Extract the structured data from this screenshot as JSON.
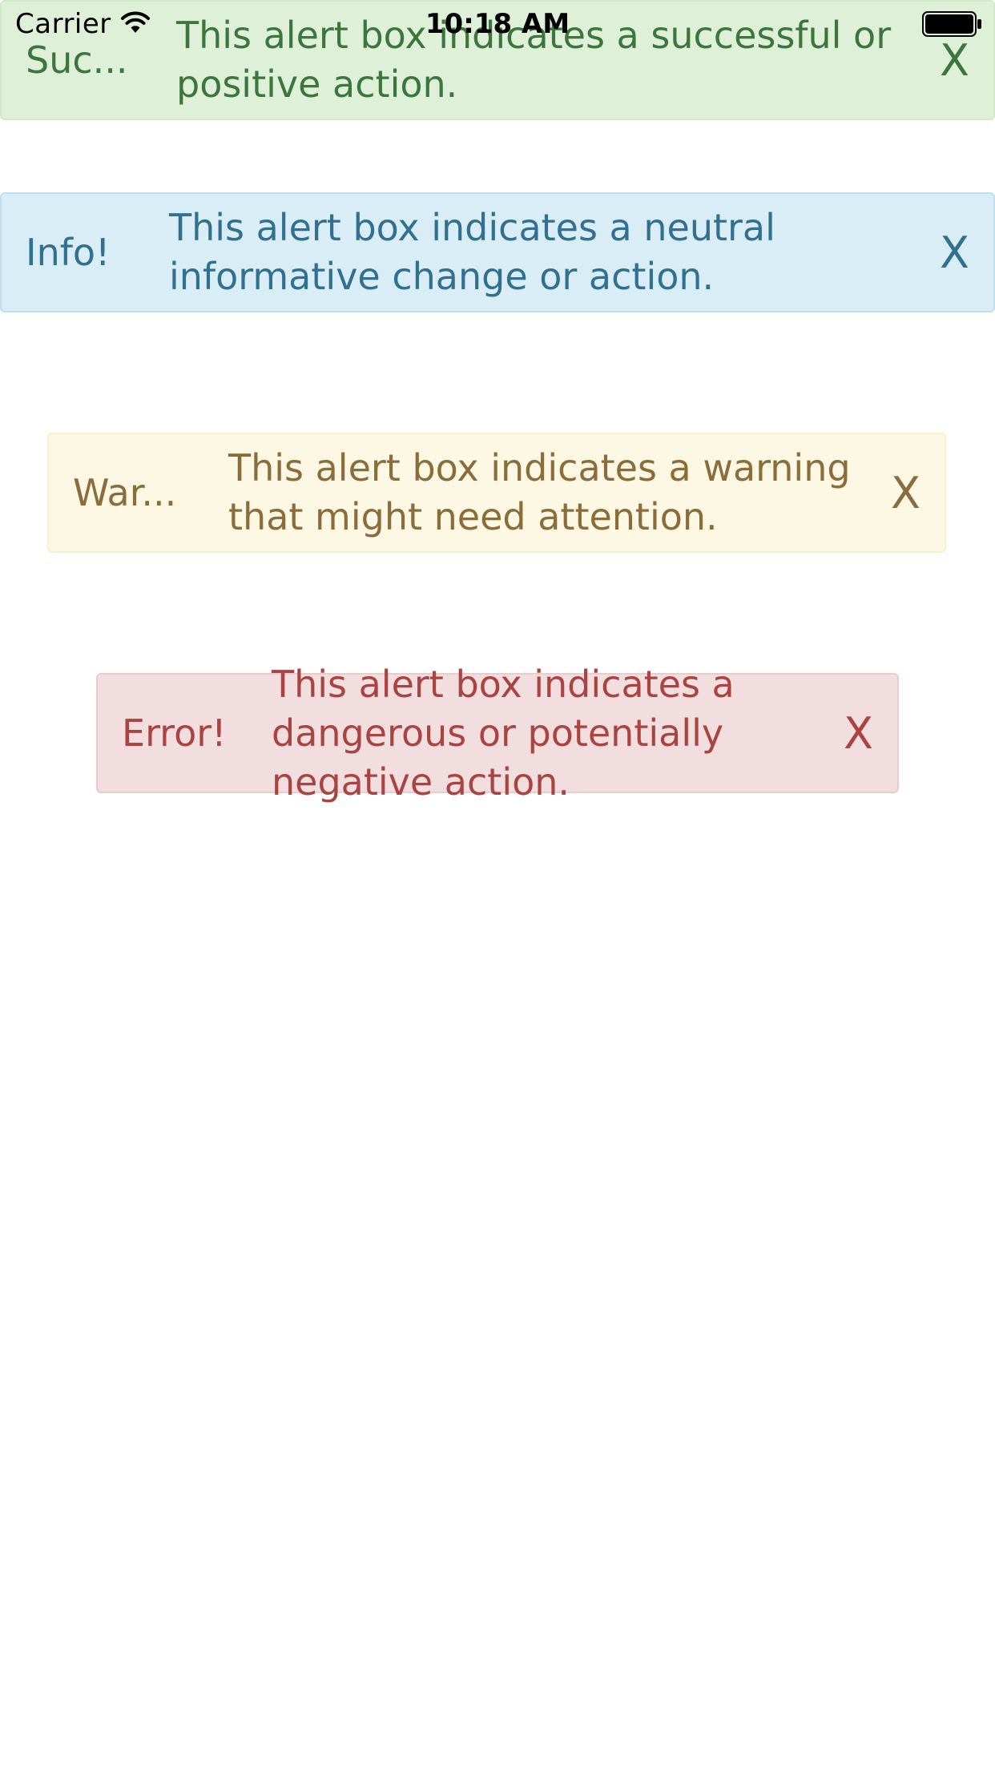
{
  "status_bar": {
    "carrier": "Carrier",
    "time": "10:18 AM",
    "wifi_icon": "wifi-icon",
    "battery_icon": "battery-full-icon"
  },
  "alerts": [
    {
      "type": "success",
      "title": "Suc...",
      "message": "This alert box indicates a successful or positive action.",
      "close_label": "X",
      "color": "#3c763d",
      "background": "#dff0d8"
    },
    {
      "type": "info",
      "title": "Info!",
      "message": "This alert box indicates a neutral informative change or action.",
      "close_label": "X",
      "color": "#31708f",
      "background": "#d9edf7"
    },
    {
      "type": "warning",
      "title": "War...",
      "message": "This alert box indicates a warning that might need attention.",
      "close_label": "X",
      "color": "#8a6d3b",
      "background": "#fcf8e3"
    },
    {
      "type": "error",
      "title": "Error!",
      "message": "This alert box indicates a dangerous or potentially negative action.",
      "close_label": "X",
      "color": "#a94442",
      "background": "#f2dede"
    }
  ]
}
